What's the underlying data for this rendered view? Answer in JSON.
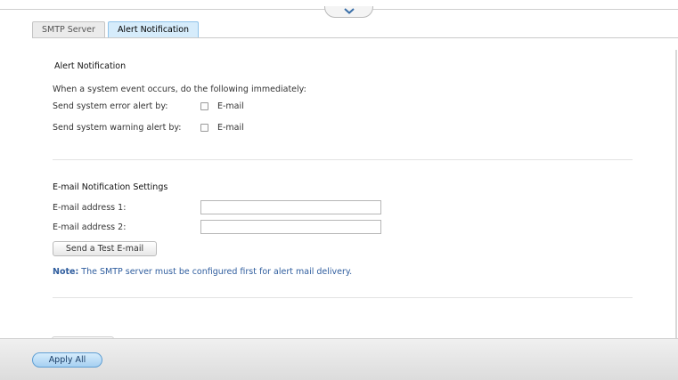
{
  "tabs": [
    {
      "label": "SMTP Server",
      "active": false
    },
    {
      "label": "Alert Notification",
      "active": true
    }
  ],
  "alert": {
    "title": "Alert Notification",
    "description": "When a system event occurs, do the following immediately:",
    "error_label": "Send system error alert by:",
    "error_option": "E-mail",
    "error_checked": false,
    "warning_label": "Send system warning alert by:",
    "warning_option": "E-mail",
    "warning_checked": false
  },
  "email": {
    "title": "E-mail Notification Settings",
    "address1_label": "E-mail address 1:",
    "address1_value": "",
    "address2_label": "E-mail address 2:",
    "address2_value": "",
    "test_button": "Send a Test E-mail",
    "note_prefix": "Note:",
    "note_text": " The SMTP server must be configured first for alert mail delivery."
  },
  "footer": {
    "apply_label": "Apply All"
  },
  "icons": {
    "collapse": "chevron-down-icon"
  },
  "colors": {
    "active_tab": "#d6ecfb",
    "note_text": "#2f5d9e",
    "apply_button": "#a6d0f1"
  }
}
